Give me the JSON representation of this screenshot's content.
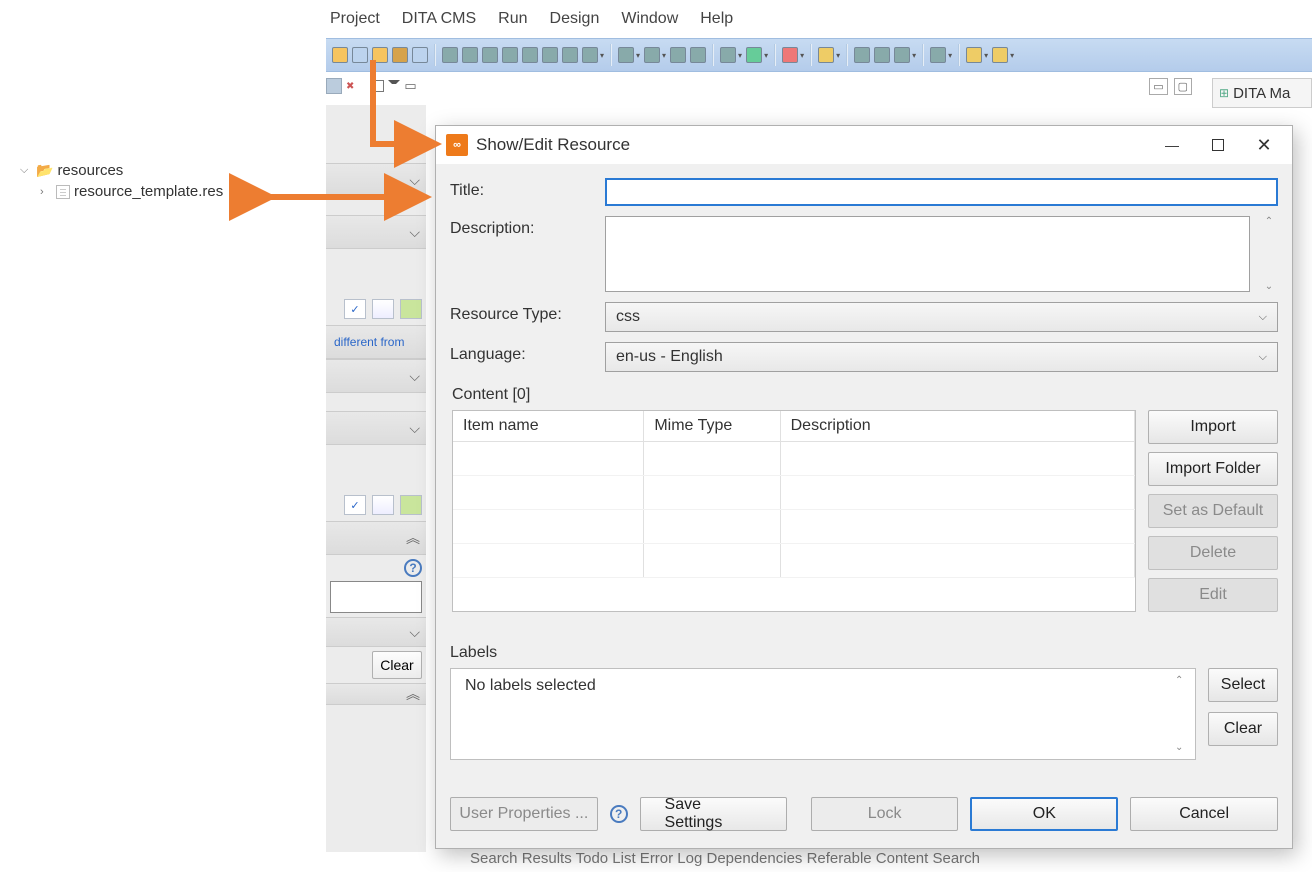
{
  "menu": {
    "project": "Project",
    "dita": "DITA CMS",
    "run": "Run",
    "design": "Design",
    "window": "Window",
    "help": "Help"
  },
  "tree": {
    "root": "resources",
    "file": "resource_template.res"
  },
  "editor": {
    "fragment_link": "different from",
    "clear": "Clear"
  },
  "right_tab": {
    "label": "DITA Ma"
  },
  "dialog": {
    "title": "Show/Edit Resource",
    "labels": {
      "title": "Title:",
      "description": "Description:",
      "rtype": "Resource Type:",
      "language": "Language:",
      "content": "Content [0]",
      "labels": "Labels"
    },
    "values": {
      "title": "",
      "description": "",
      "rtype": "css",
      "language": "en-us - English",
      "labels_text": "No labels selected"
    },
    "table": {
      "col1": "Item name",
      "col2": "Mime Type",
      "col3": "Description"
    },
    "buttons": {
      "import": "Import",
      "import_folder": "Import Folder",
      "set_default": "Set as Default",
      "delete": "Delete",
      "edit": "Edit",
      "select": "Select",
      "clear": "Clear",
      "user_props": "User Properties ...",
      "save": "Save Settings",
      "lock": "Lock",
      "ok": "OK",
      "cancel": "Cancel"
    }
  },
  "bottom": "Search Results   Todo List   Error Log   Dependencies   Referable Content   Search"
}
